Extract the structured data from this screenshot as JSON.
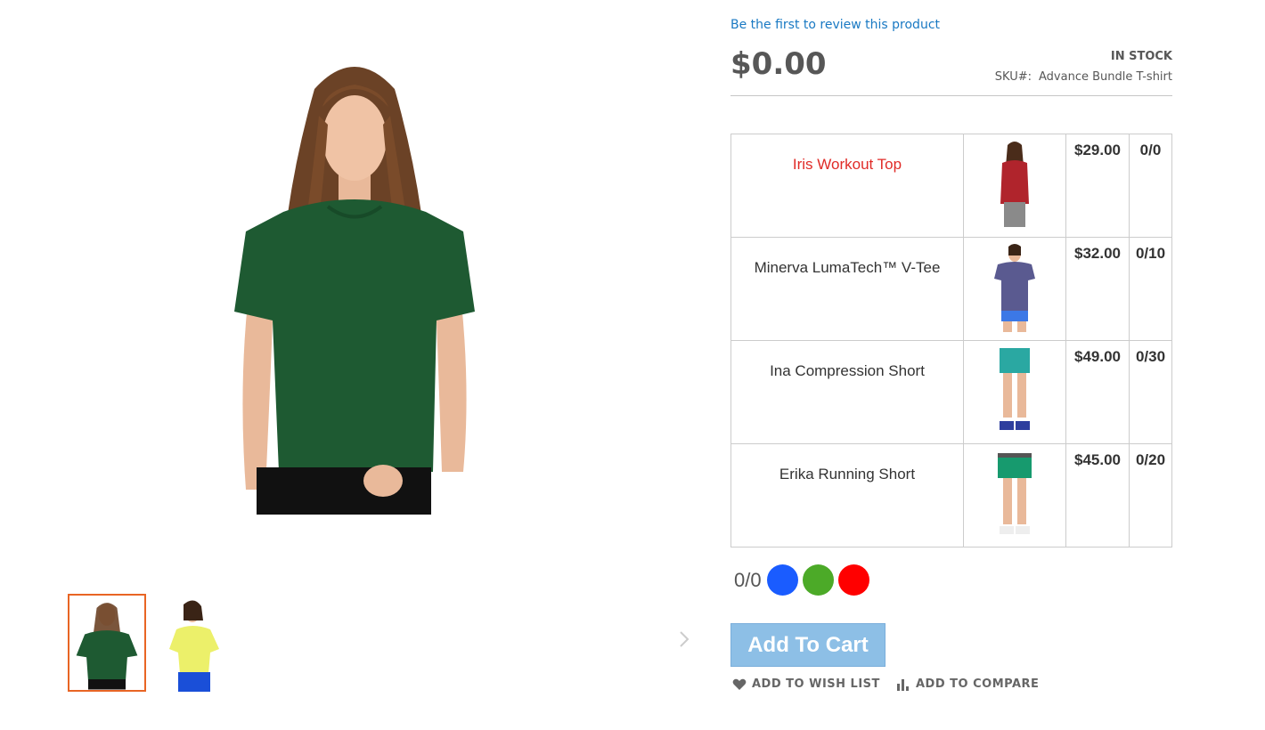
{
  "product": {
    "review_link": "Be the first to review this product",
    "price": "$0.00",
    "stock": "IN STOCK",
    "sku_label": "SKU#:",
    "sku_value": "Advance Bundle T-shirt"
  },
  "gallery": {
    "main_image": "woman-green-tshirt-photo",
    "thumbnails": [
      {
        "image": "woman-green-tshirt-thumb",
        "active": true
      },
      {
        "image": "woman-yellow-vtee-thumb",
        "active": false
      }
    ],
    "next_icon": "chevron-right-icon"
  },
  "bundle_items": [
    {
      "name": "Iris Workout Top",
      "name_color": "#e02b27",
      "image": "red-workout-top-photo",
      "price": "$29.00",
      "qty": "0/0"
    },
    {
      "name": "Minerva LumaTech™ V-Tee",
      "name_color": "#333333",
      "image": "purple-vtee-photo",
      "price": "$32.00",
      "qty": "0/10"
    },
    {
      "name": "Ina Compression Short",
      "name_color": "#333333",
      "image": "teal-compression-short-photo",
      "price": "$49.00",
      "qty": "0/30"
    },
    {
      "name": "Erika Running Short",
      "name_color": "#333333",
      "image": "green-running-short-photo",
      "price": "$45.00",
      "qty": "0/20"
    }
  ],
  "swatches": {
    "counter": "0/0",
    "colors": [
      "#1a5cff",
      "#4caa28",
      "#ff0000"
    ]
  },
  "actions": {
    "add_to_cart": "Add To Cart",
    "wish_list": "ADD TO WISH LIST",
    "compare": "ADD TO COMPARE",
    "wish_icon": "heart-icon",
    "compare_icon": "bar-chart-icon"
  },
  "colors": {
    "link": "#1979c3",
    "thumb_active_border": "#e86524",
    "button_bg": "#8dbfe6"
  }
}
